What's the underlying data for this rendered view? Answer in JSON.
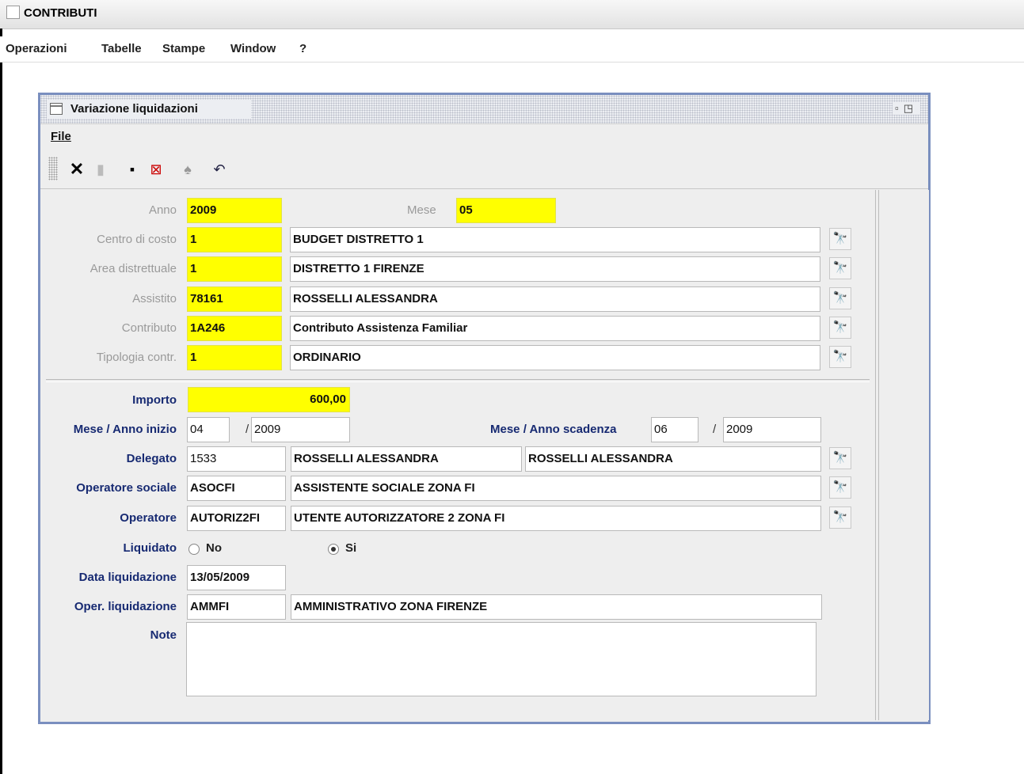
{
  "app": {
    "title": "CONTRIBUTI",
    "menu": [
      "Operazioni",
      "Tabelle",
      "Stampe",
      "Window",
      "?"
    ]
  },
  "window": {
    "title": "Variazione liquidazioni",
    "menu_file": "File",
    "toolbar_icons": [
      "close-x-icon",
      "new-document-icon",
      "save-icon",
      "delete-icon",
      "search-binoculars-icon",
      "undo-icon"
    ]
  },
  "form": {
    "anno": {
      "label": "Anno",
      "value": "2009"
    },
    "mese": {
      "label": "Mese",
      "value": "05"
    },
    "centro_costo": {
      "label": "Centro di costo",
      "code": "1",
      "desc": "BUDGET DISTRETTO 1"
    },
    "area_distrettuale": {
      "label": "Area distrettuale",
      "code": "1",
      "desc": "DISTRETTO 1 FIRENZE"
    },
    "assistito": {
      "label": "Assistito",
      "code": "78161",
      "desc": "ROSSELLI ALESSANDRA"
    },
    "contributo": {
      "label": "Contributo",
      "code": "1A246",
      "desc": "Contributo Assistenza Familiar"
    },
    "tipologia": {
      "label": "Tipologia contr.",
      "code": "1",
      "desc": "ORDINARIO"
    },
    "importo": {
      "label": "Importo",
      "value": "600,00"
    },
    "inizio": {
      "label": "Mese / Anno inizio",
      "mese": "04",
      "anno": "2009"
    },
    "scadenza": {
      "label": "Mese / Anno scadenza",
      "mese": "06",
      "anno": "2009"
    },
    "slash": "/",
    "delegato": {
      "label": "Delegato",
      "code": "1533",
      "desc1": "ROSSELLI ALESSANDRA",
      "desc2": "ROSSELLI ALESSANDRA"
    },
    "operatore_sociale": {
      "label": "Operatore sociale",
      "code": "ASOCFI",
      "desc": "ASSISTENTE SOCIALE ZONA FI"
    },
    "operatore": {
      "label": "Operatore",
      "code": "AUTORIZ2FI",
      "desc": "UTENTE AUTORIZZATORE 2 ZONA FI"
    },
    "liquidato": {
      "label": "Liquidato",
      "option_no": "No",
      "option_si": "Si",
      "selected": "Si"
    },
    "data_liquidazione": {
      "label": "Data liquidazione",
      "value": "13/05/2009"
    },
    "oper_liquidazione": {
      "label": "Oper. liquidazione",
      "code": "AMMFI",
      "desc": "AMMINISTRATIVO ZONA FIRENZE"
    },
    "note": {
      "label": "Note",
      "value": ""
    }
  },
  "colors": {
    "required_field": "#ffff00",
    "label_blue": "#172a72",
    "frame_border": "#7a8fbf"
  }
}
